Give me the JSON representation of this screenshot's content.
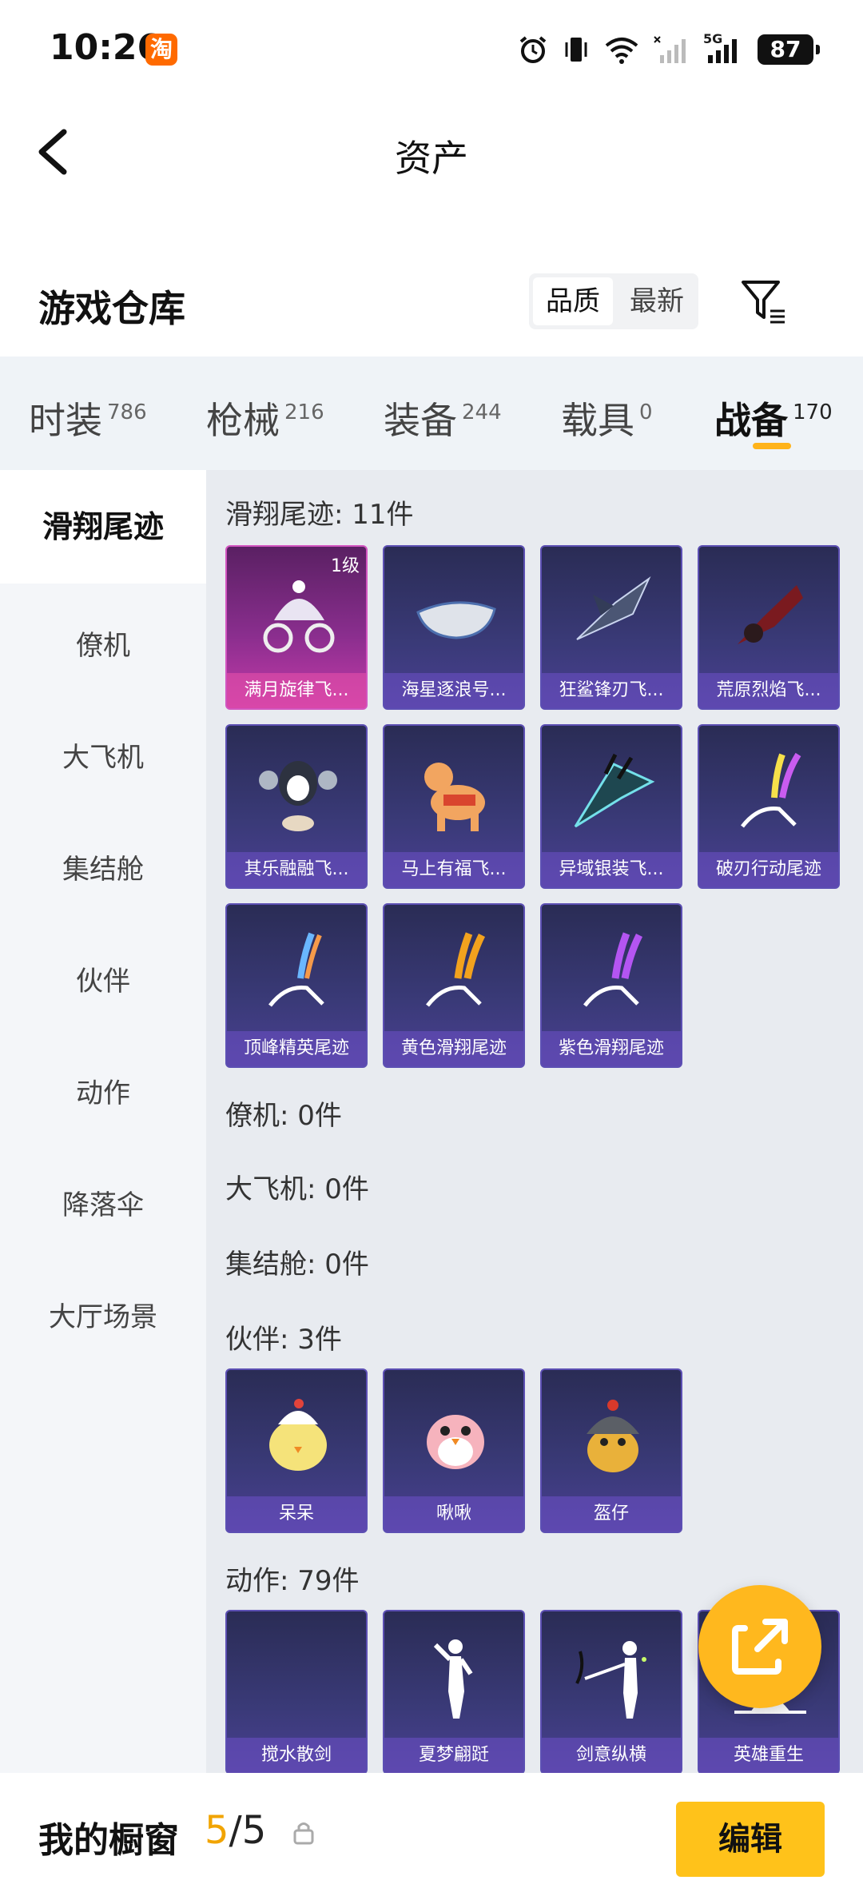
{
  "status": {
    "time": "10:26",
    "app_badge": "淘",
    "network": "5G",
    "battery": "87"
  },
  "nav": {
    "title": "资产"
  },
  "section": {
    "title": "游戏仓库",
    "sort_options": [
      "品质",
      "最新"
    ]
  },
  "tabs": [
    {
      "label": "时装",
      "count": "786"
    },
    {
      "label": "枪械",
      "count": "216"
    },
    {
      "label": "装备",
      "count": "244"
    },
    {
      "label": "载具",
      "count": "0"
    },
    {
      "label": "战备",
      "count": "170"
    }
  ],
  "sidebar": [
    "滑翔尾迹",
    "僚机",
    "大飞机",
    "集结舱",
    "伙伴",
    "动作",
    "降落伞",
    "大厅场景"
  ],
  "groups": {
    "glide": {
      "title": "滑翔尾迹: 11件",
      "items": [
        {
          "name": "满月旋律飞...",
          "level": "1级"
        },
        {
          "name": "海星逐浪号..."
        },
        {
          "name": "狂鲨锋刃飞..."
        },
        {
          "name": "荒原烈焰飞..."
        },
        {
          "name": "其乐融融飞..."
        },
        {
          "name": "马上有福飞..."
        },
        {
          "name": "异域银装飞..."
        },
        {
          "name": "破刃行动尾迹"
        },
        {
          "name": "顶峰精英尾迹"
        },
        {
          "name": "黄色滑翔尾迹"
        },
        {
          "name": "紫色滑翔尾迹"
        }
      ]
    },
    "wingman": {
      "title": "僚机: 0件"
    },
    "plane": {
      "title": "大飞机: 0件"
    },
    "pod": {
      "title": "集结舱: 0件"
    },
    "partner": {
      "title": "伙伴: 3件",
      "items": [
        {
          "name": "呆呆"
        },
        {
          "name": "啾啾"
        },
        {
          "name": "盔仔"
        }
      ]
    },
    "emote": {
      "title": "动作: 79件",
      "items": [
        {
          "name": "搅水散剑"
        },
        {
          "name": "夏梦翩跹"
        },
        {
          "name": "剑意纵横"
        },
        {
          "name": "英雄重生"
        }
      ]
    }
  },
  "bottom": {
    "title": "我的橱窗",
    "count_current": "5",
    "count_sep_total": "/5",
    "edit_label": "编辑"
  },
  "colors": {
    "accent": "#ffb31a",
    "edit_button": "#ffc21a",
    "card_purple": "#3a3a78",
    "card_gold": "#c43aa8"
  }
}
